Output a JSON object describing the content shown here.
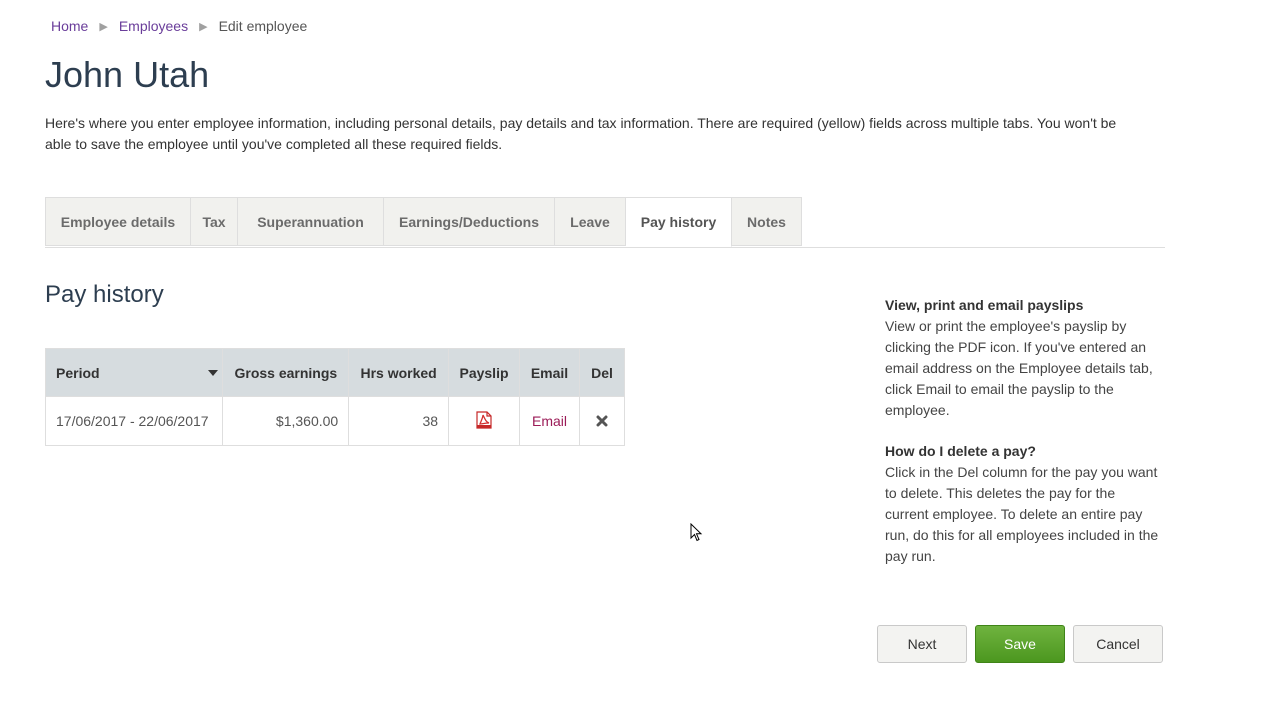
{
  "breadcrumb": {
    "home": "Home",
    "employees": "Employees",
    "current": "Edit employee",
    "separator": "▶"
  },
  "page_title": "John Utah",
  "intro": "Here's where you enter employee information, including personal details, pay details and tax information. There are required (yellow) fields across multiple tabs. You won't be able to save the employee until you've completed all these required fields.",
  "tabs": [
    {
      "label": "Employee details"
    },
    {
      "label": "Tax"
    },
    {
      "label": "Superannuation"
    },
    {
      "label": "Earnings/Deductions"
    },
    {
      "label": "Leave"
    },
    {
      "label": "Pay history"
    },
    {
      "label": "Notes"
    }
  ],
  "active_tab": "Pay history",
  "section_title": "Pay history",
  "table": {
    "headers": {
      "period": "Period",
      "gross": "Gross earnings",
      "hours": "Hrs worked",
      "payslip": "Payslip",
      "email": "Email",
      "del": "Del"
    },
    "rows": [
      {
        "period": "17/06/2017 - 22/06/2017",
        "gross": "$1,360.00",
        "hours": "38",
        "payslip_icon": "pdf-icon",
        "email": "Email",
        "del_icon": "delete-x-icon"
      }
    ]
  },
  "help": {
    "heading1": "View, print and email payslips",
    "text1": "View or print the employee's payslip by clicking the PDF icon. If you've entered an email address on the Employee details tab, click Email to email the payslip to the employee.",
    "heading2": "How do I delete a pay?",
    "text2": "Click in the Del column for the pay you want to delete. This deletes the pay for the current employee. To delete an entire pay run, do this for all employees included in the pay run."
  },
  "buttons": {
    "next": "Next",
    "save": "Save",
    "cancel": "Cancel"
  },
  "colors": {
    "link": "#6a3d9a",
    "email_link": "#9b1b57",
    "save_button": "#5aa32b",
    "title": "#2d3e50",
    "table_header": "#d6dcdf"
  }
}
